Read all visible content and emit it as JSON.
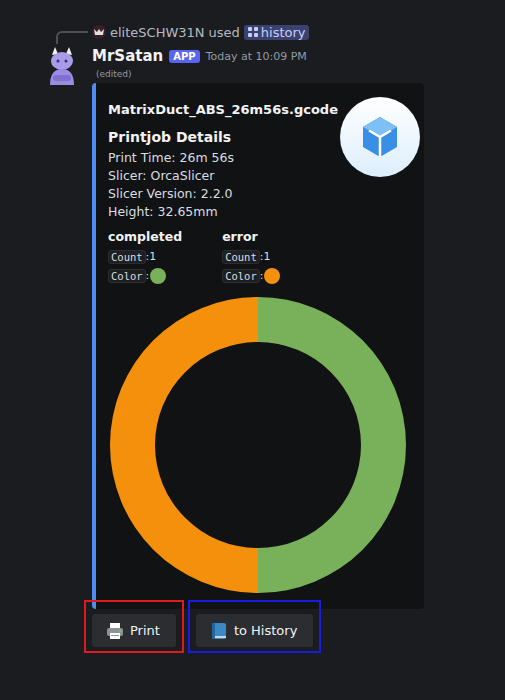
{
  "reply": {
    "user": "eliteSCHW31N",
    "verb": "used",
    "command": "history"
  },
  "message": {
    "author": "MrSatan",
    "badge": "APP",
    "timestamp": "Today at 10:09 PM",
    "edited": "(edited)"
  },
  "embed": {
    "title": "MatrixDuct_ABS_26m56s.gcode",
    "subtitle": "Printjob Details",
    "details": [
      "Print Time: 26m 56s",
      "Slicer: OrcaSlicer",
      "Slicer Version: 2.2.0",
      "Height: 32.65mm"
    ],
    "fields": [
      {
        "name": "completed",
        "count_label": "Count",
        "count_value": ":1",
        "color_label": "Color",
        "color_sep": ":",
        "color": "#78b159"
      },
      {
        "name": "error",
        "count_label": "Count",
        "count_value": ":1",
        "color_label": "Color",
        "color_sep": ":",
        "color": "#f4900c"
      }
    ],
    "chart": {
      "series": [
        {
          "name": "completed",
          "value": 1,
          "color": "#78b159"
        },
        {
          "name": "error",
          "value": 1,
          "color": "#f4900c"
        }
      ]
    }
  },
  "buttons": [
    {
      "label": "Print",
      "color": "#e01b1b"
    },
    {
      "label": "to History",
      "color": "#1a1ae0"
    }
  ]
}
